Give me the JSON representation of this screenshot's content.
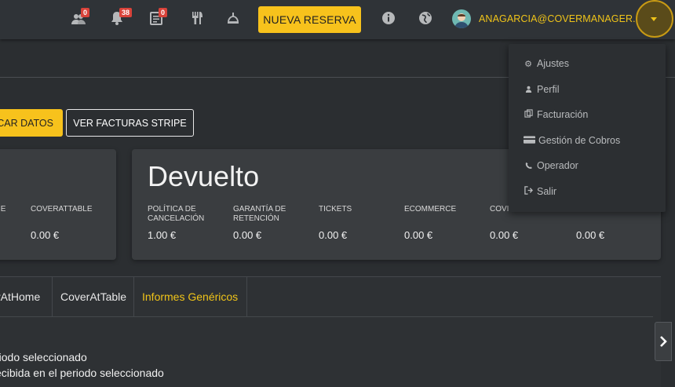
{
  "topbar": {
    "icons": [
      {
        "name": "groups-icon",
        "badge": "0"
      },
      {
        "name": "bell-icon",
        "badge": "38"
      },
      {
        "name": "clipboard-icon",
        "badge": "0"
      },
      {
        "name": "cutlery-icon"
      },
      {
        "name": "hand-bell-icon"
      }
    ],
    "new_reservation_label": "NUEVA RESERVA",
    "info_icon": "info-icon",
    "globe_icon": "globe-icon",
    "user_email": "ANAGARCIA@COVERMANAGER.COM"
  },
  "actions": {
    "partial_button_label": "CAR DATOS",
    "stripe_button_label": "VER FACTURAS STRIPE"
  },
  "card_left": {
    "columns": [
      {
        "label": "IE",
        "value": ""
      },
      {
        "label": "COVERATTABLE",
        "value": "0.00 €"
      }
    ]
  },
  "card_right": {
    "title": "Devuelto",
    "columns": [
      {
        "label": "POLÍTICA DE CANCELACIÓN",
        "value": "1.00 €"
      },
      {
        "label": "GARANTÍA DE RETENCIÓN",
        "value": "0.00 €"
      },
      {
        "label": "TICKETS",
        "value": "0.00 €"
      },
      {
        "label": "ECOMMERCE",
        "value": "0.00 €"
      },
      {
        "label": "COVI",
        "value": "0.00 €"
      },
      {
        "label": "",
        "value": "0.00 €"
      }
    ]
  },
  "tabs": [
    {
      "label": "rAtHome"
    },
    {
      "label": "CoverAtTable"
    },
    {
      "label": "Informes Genéricos",
      "active": true
    }
  ],
  "body_lines": [
    "riodo seleccionado",
    "ecibida en el periodo seleccionado"
  ],
  "dropdown": {
    "items": [
      {
        "icon": "gear-icon",
        "label": "Ajustes"
      },
      {
        "icon": "user-icon",
        "label": "Perfil"
      },
      {
        "icon": "copy-icon",
        "label": "Facturación"
      },
      {
        "icon": "credit-card-icon",
        "label": "Gestión de Cobros"
      },
      {
        "icon": "phone-icon",
        "label": "Operador"
      },
      {
        "icon": "sign-out-icon",
        "label": "Salir"
      }
    ]
  },
  "colors": {
    "accent": "#f7c21c",
    "background": "#2b2e31",
    "card": "#3a3d40",
    "badge": "#d9433a"
  }
}
